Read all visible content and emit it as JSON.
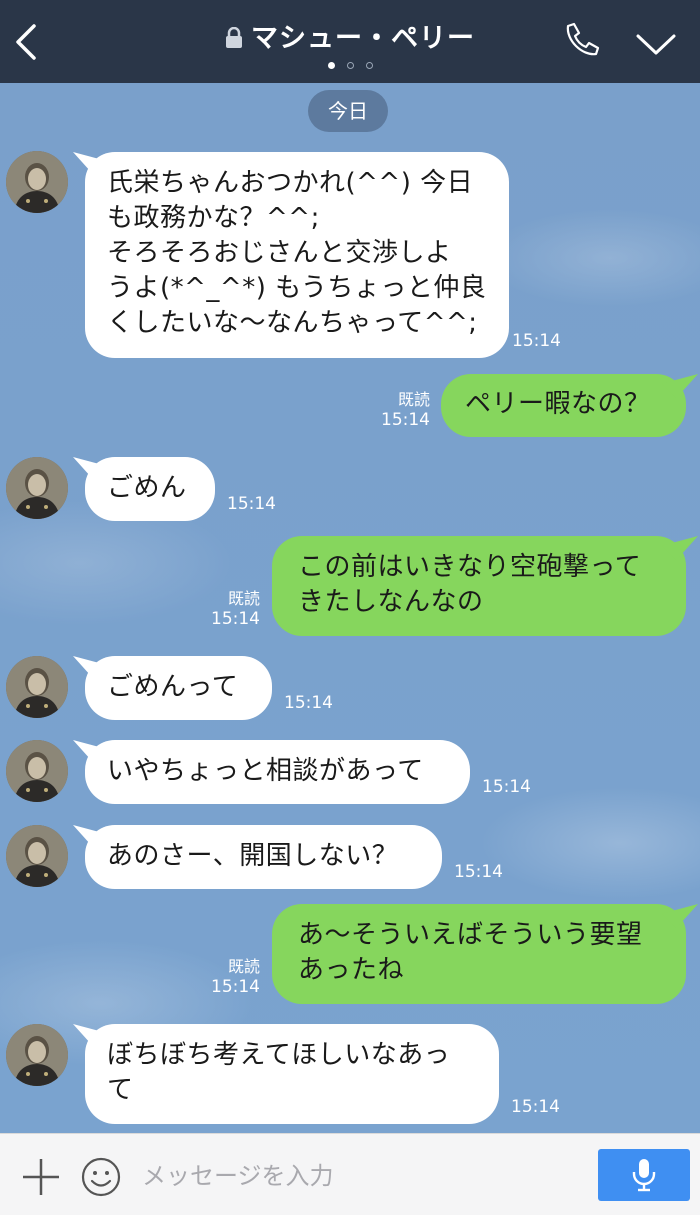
{
  "header": {
    "title": "マシュー・ペリー",
    "page_dots": 3,
    "active_dot": 1
  },
  "date_separator": "今日",
  "messages": [
    {
      "side": "in",
      "text": "氏栄ちゃんおつかれ(^^) 今日\nも政務かな？^^;\nそろそろおじさんと交渉しよ\nうよ(*^_^*) もうちょっと仲良\nくしたいな〜なんちゃって^^;",
      "time": "15:14"
    },
    {
      "side": "out",
      "text": "ペリー暇なの？",
      "read": "既読",
      "time": "15:14"
    },
    {
      "side": "in",
      "text": "ごめん",
      "time": "15:14"
    },
    {
      "side": "out",
      "text": "この前はいきなり空砲撃って\nきたしなんなの",
      "read": "既読",
      "time": "15:14"
    },
    {
      "side": "in",
      "text": "ごめんって",
      "time": "15:14"
    },
    {
      "side": "in",
      "text": "いやちょっと相談があって",
      "time": "15:14"
    },
    {
      "side": "in",
      "text": "あのさー、開国しない？",
      "time": "15:14"
    },
    {
      "side": "out",
      "text": "あ〜そういえばそういう要望\nあったね",
      "read": "既読",
      "time": "15:14"
    },
    {
      "side": "in",
      "text": "ぼちぼち考えてほしいなあっ\nて",
      "time": "15:14"
    }
  ],
  "composer": {
    "placeholder": "メッセージを入力"
  },
  "colors": {
    "header_bg": "#2a3648",
    "chat_bg": "#7aa0cb",
    "outgoing_bubble": "#86d65d",
    "incoming_bubble": "#ffffff",
    "mic_button": "#3f8ff2"
  }
}
